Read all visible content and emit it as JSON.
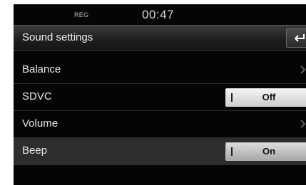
{
  "status": {
    "indicator": "REG",
    "time": "00:47"
  },
  "header": {
    "title": "Sound settings",
    "back_icon": "back-arrow-icon"
  },
  "rows": [
    {
      "label": "Balance",
      "control": "chevron"
    },
    {
      "label": "SDVC",
      "control": "toggle",
      "state": "Off"
    },
    {
      "label": "Volume",
      "control": "chevron"
    },
    {
      "label": "Beep",
      "control": "toggle",
      "state": "On",
      "selected": true
    }
  ],
  "colors": {
    "background": "#050505",
    "toggle_off": "#e6e6e6",
    "toggle_on": "#c2c2c2",
    "selected_row": "#2d2d2d"
  }
}
